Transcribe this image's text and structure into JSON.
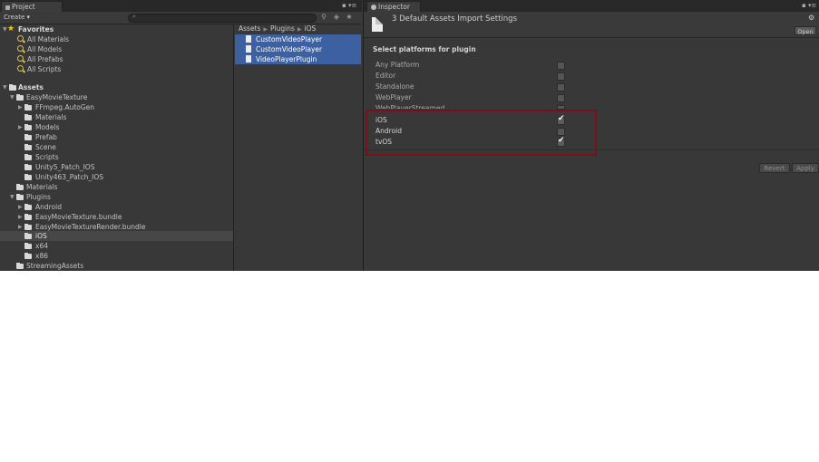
{
  "project_panel": {
    "tab_label": "Project",
    "create_label": "Create",
    "search_placeholder": "",
    "tree": {
      "favorites_label": "Favorites",
      "favorites": [
        "All Materials",
        "All Models",
        "All Prefabs",
        "All Scripts"
      ],
      "assets_label": "Assets",
      "items": [
        {
          "label": "EasyMovieTexture"
        },
        {
          "label": "FFmpeg.AutoGen"
        },
        {
          "label": "Materials"
        },
        {
          "label": "Models"
        },
        {
          "label": "Prefab"
        },
        {
          "label": "Scene"
        },
        {
          "label": "Scripts"
        },
        {
          "label": "Unity5_Patch_IOS"
        },
        {
          "label": "Unity463_Patch_IOS"
        },
        {
          "label": "Materials"
        },
        {
          "label": "Plugins"
        },
        {
          "label": "Android"
        },
        {
          "label": "EasyMovieTexture.bundle"
        },
        {
          "label": "EasyMovieTextureRender.bundle"
        },
        {
          "label": "iOS"
        },
        {
          "label": "x64"
        },
        {
          "label": "x86"
        },
        {
          "label": "StreamingAssets"
        }
      ]
    },
    "breadcrumb": [
      "Assets",
      "Plugins",
      "iOS"
    ],
    "files": [
      "CustomVideoPlayer",
      "CustomVideoPlayer",
      "VideoPlayerPlugin"
    ]
  },
  "inspector": {
    "tab_label": "Inspector",
    "title": "3 Default Assets Import Settings",
    "open_label": "Open",
    "section_title": "Select platforms for plugin",
    "platforms": [
      {
        "label": "Any Platform",
        "checked": false
      },
      {
        "label": "Editor",
        "checked": false
      },
      {
        "label": "Standalone",
        "checked": false
      },
      {
        "label": "WebPlayer",
        "checked": false
      },
      {
        "label": "WebPlayerStreamed",
        "checked": false
      },
      {
        "label": "iOS",
        "checked": true
      },
      {
        "label": "Android",
        "checked": false
      },
      {
        "label": "tvOS",
        "checked": true
      }
    ],
    "revert_label": "Revert",
    "apply_label": "Apply"
  },
  "colors": {
    "selection": "#3d60a0",
    "highlight_box": "#7d0f1d",
    "favorites_star": "#f2c419"
  }
}
